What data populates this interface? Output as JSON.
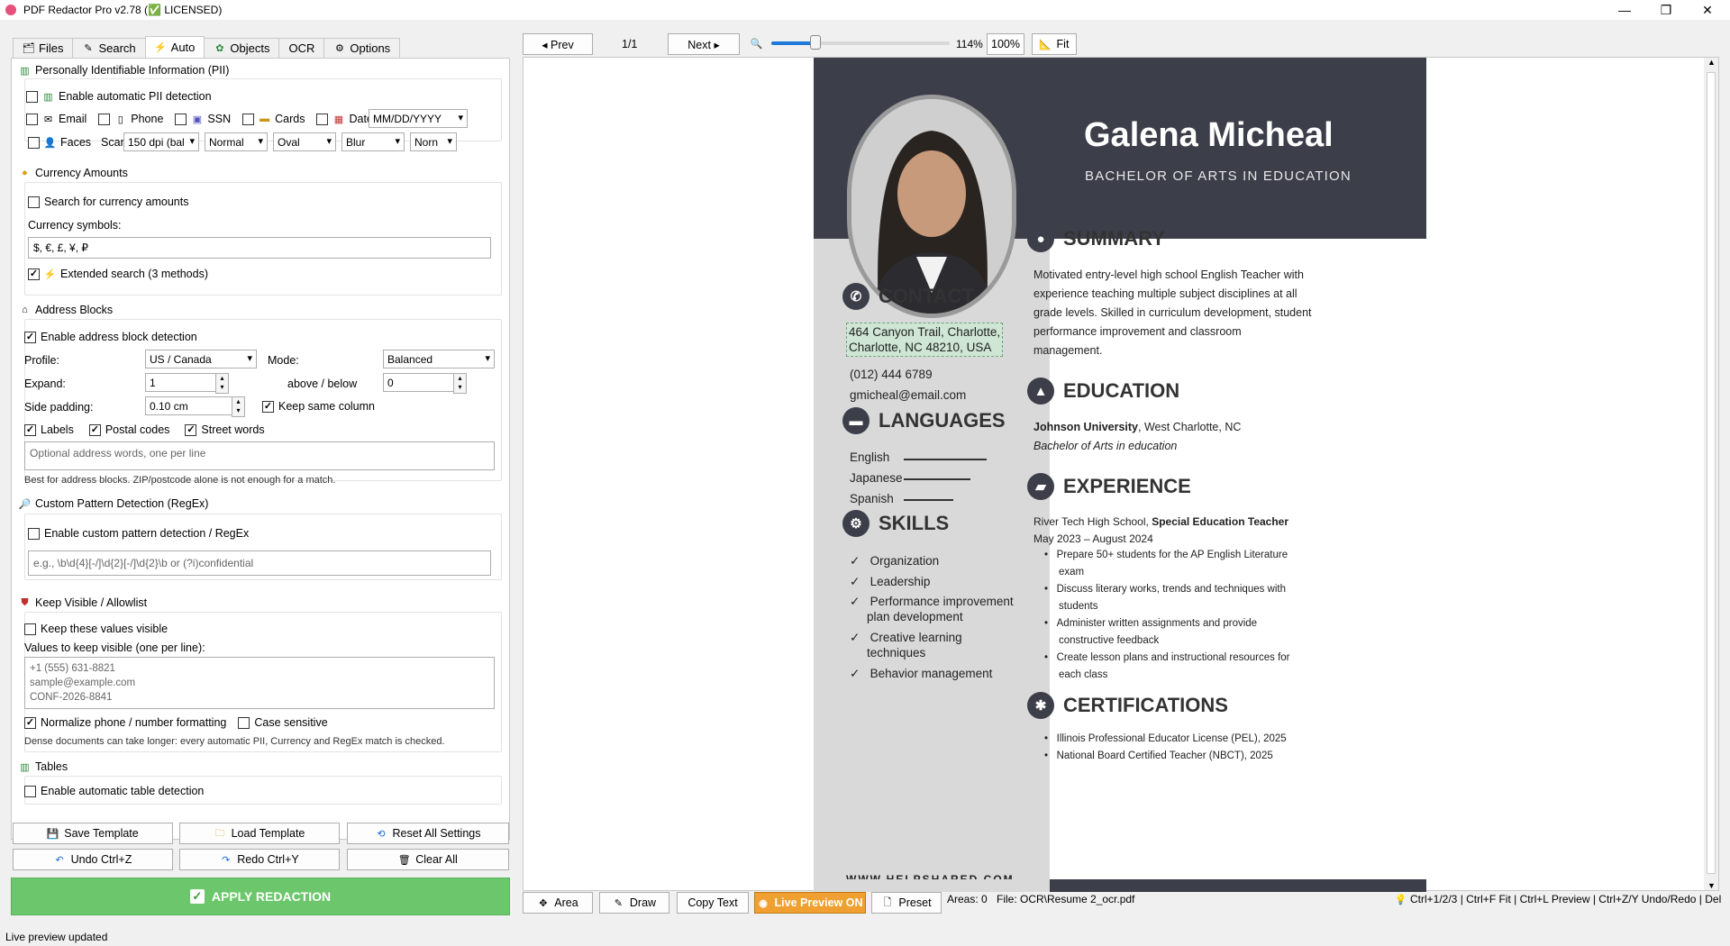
{
  "window": {
    "title": "PDF Redactor Pro v2.78 (✅ LICENSED)"
  },
  "tabs": [
    {
      "icon": "folder-icon",
      "label": "Files"
    },
    {
      "icon": "pencil-icon",
      "label": "Search"
    },
    {
      "icon": "bolt-icon",
      "label": "Auto"
    },
    {
      "icon": "shapes-icon",
      "label": "Objects"
    },
    {
      "icon": "",
      "label": "OCR"
    },
    {
      "icon": "gear-icon",
      "label": "Options"
    }
  ],
  "active_tab": "Auto",
  "pii": {
    "title": "Personally Identifiable Information (PII)",
    "enable_label": "Enable automatic PII detection",
    "enable_checked": false,
    "email_label": "Email",
    "phone_label": "Phone",
    "ssn_label": "SSN",
    "cards_label": "Cards",
    "dates_label": "Dates:",
    "date_format": "MM/DD/YYYY",
    "faces_label": "Faces",
    "scan_label": "Scan:",
    "scan_value": "150 dpi (bal",
    "mode_value": "Normal",
    "shape_value": "Oval",
    "effect_value": "Blur",
    "extra_value": "Norn"
  },
  "currency": {
    "title": "Currency Amounts",
    "search_label": "Search for currency amounts",
    "symbols_label": "Currency symbols:",
    "symbols_value": "$, €, £, ¥, ₽",
    "extended_label": "Extended search (3 methods)",
    "extended_checked": true
  },
  "address": {
    "title": "Address Blocks",
    "enable_label": "Enable address block detection",
    "enable_checked": true,
    "profile_label": "Profile:",
    "profile_value": "US / Canada",
    "mode_label": "Mode:",
    "mode_value": "Balanced",
    "expand_label": "Expand:",
    "expand_value": "1",
    "above_below_label": "above / below",
    "above_below_value": "0",
    "side_padding_label": "Side padding:",
    "side_padding_value": "0.10 cm",
    "keep_column_label": "Keep same column",
    "labels_label": "Labels",
    "postal_label": "Postal codes",
    "street_label": "Street words",
    "words_placeholder": "Optional address words, one per line",
    "hint": "Best for address blocks. ZIP/postcode alone is not enough for a match."
  },
  "regex": {
    "title": "Custom Pattern Detection (RegEx)",
    "enable_label": "Enable custom pattern detection / RegEx",
    "placeholder": "e.g.,  \\b\\d{4}[-/]\\d{2}[-/]\\d{2}\\b   or   (?i)confidential"
  },
  "allowlist": {
    "title": "Keep Visible / Allowlist",
    "keep_label": "Keep these values visible",
    "values_label": "Values to keep visible (one per line):",
    "examples": [
      "+1 (555) 631-8821",
      "sample@example.com",
      "CONF-2026-8841"
    ],
    "normalize_label": "Normalize phone / number formatting",
    "case_label": "Case sensitive",
    "hint": "Dense documents can take longer: every automatic PII, Currency and RegEx match is checked."
  },
  "tables": {
    "title": "Tables",
    "enable_label": "Enable automatic table detection"
  },
  "buttons": {
    "save_template": "Save Template",
    "load_template": "Load Template",
    "reset_all": "Reset All Settings",
    "undo": "Undo  Ctrl+Z",
    "redo": "Redo  Ctrl+Y",
    "clear_all": "Clear All",
    "apply": "APPLY REDACTION"
  },
  "status_text": "Live preview updated",
  "viewer_toolbar": {
    "prev": "◂ Prev",
    "page": "1/1",
    "next": "Next ▸",
    "zoom_percent": "114%",
    "zoom_100": "100%",
    "fit": "Fit",
    "zoom_fraction": 0.26
  },
  "bottom_toolbar": {
    "area": "Area",
    "draw": "Draw",
    "copy_text": "Copy Text",
    "live_preview": "Live Preview ON",
    "preset": "Preset",
    "areas_label": "Areas: 0",
    "file_label": "File: OCR\\Resume 2_ocr.pdf",
    "shortcuts": "Ctrl+1/2/3 | Ctrl+F Fit | Ctrl+L Preview | Ctrl+Z/Y Undo/Redo | Del"
  },
  "colors": {
    "apply_green": "#6cc76c",
    "live_preview_orange": "#f0a030",
    "resume_dark": "#3c3f4a",
    "resume_sidebar": "#d9d9d9"
  },
  "resume": {
    "name": "Galena Micheal",
    "subtitle": "BACHELOR OF ARTS IN EDUCATION",
    "contact_title": "CONTACT",
    "address_line1": "464 Canyon Trail, Charlotte,",
    "address_line2": "Charlotte, NC 48210, USA",
    "phone": "(012) 444 6789",
    "email": "gmicheal@email.com",
    "languages_title": "LANGUAGES",
    "languages": [
      {
        "name": "English",
        "level": 1.0
      },
      {
        "name": "Japanese",
        "level": 0.8
      },
      {
        "name": "Spanish",
        "level": 0.6
      }
    ],
    "skills_title": "SKILLS",
    "skills": [
      "Organization",
      "Leadership",
      "Performance improvement",
      "plan development",
      "Creative learning",
      "techniques",
      "Behavior management"
    ],
    "website": "WWW.HELPSHARED.COM",
    "summary_title": "SUMMARY",
    "summary_lines": [
      " Motivated entry-level high school English Teacher with",
      "experience teaching multiple subject disciplines at all",
      "grade levels. Skilled in curriculum development, student",
      "performance improvement and classroom",
      "management."
    ],
    "education_title": "EDUCATION",
    "edu_school": "Johnson University",
    "edu_place": ", West Charlotte, NC",
    "edu_degree": "Bachelor of Arts in education",
    "experience_title": "EXPERIENCE",
    "exp_employer": "River Tech High School, ",
    "exp_role": "Special Education Teacher",
    "exp_dates": "May 2023 – August 2024",
    "exp_bullets": [
      [
        "Prepare 50+ students for the AP English Literature",
        "exam"
      ],
      [
        "Discuss literary works, trends and techniques with",
        "students"
      ],
      [
        "Administer written assignments and provide",
        "constructive feedback"
      ],
      [
        "Create lesson plans and instructional resources for",
        "each class"
      ]
    ],
    "cert_title": "CERTIFICATIONS",
    "certs": [
      "Illinois Professional Educator License (PEL), 2025",
      "National Board Certified Teacher (NBCT), 2025"
    ]
  }
}
